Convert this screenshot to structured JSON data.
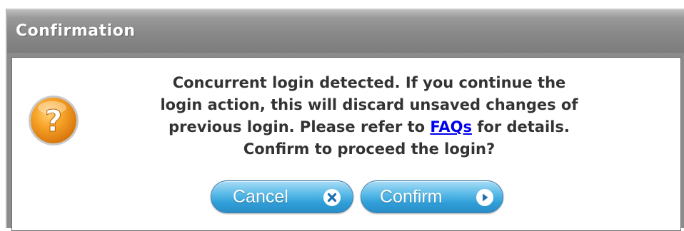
{
  "dialog": {
    "title": "Confirmation",
    "message": {
      "line1": "Concurrent login detected. If you continue the",
      "line2": "login action, this will discard unsaved changes of",
      "line3_before_link": "previous login. Please refer to ",
      "link_text": "FAQs",
      "line3_after_link": " for details.",
      "line4": "Confirm to proceed the login?"
    },
    "icon": "question-icon",
    "buttons": {
      "cancel_label": "Cancel",
      "cancel_icon": "close-icon",
      "confirm_label": "Confirm",
      "confirm_icon": "arrow-right-icon"
    }
  },
  "colors": {
    "titlebar": "#8a8a8a",
    "button": "#5bbbe8",
    "link": "#0000ee",
    "icon_orange": "#f59a1c"
  }
}
